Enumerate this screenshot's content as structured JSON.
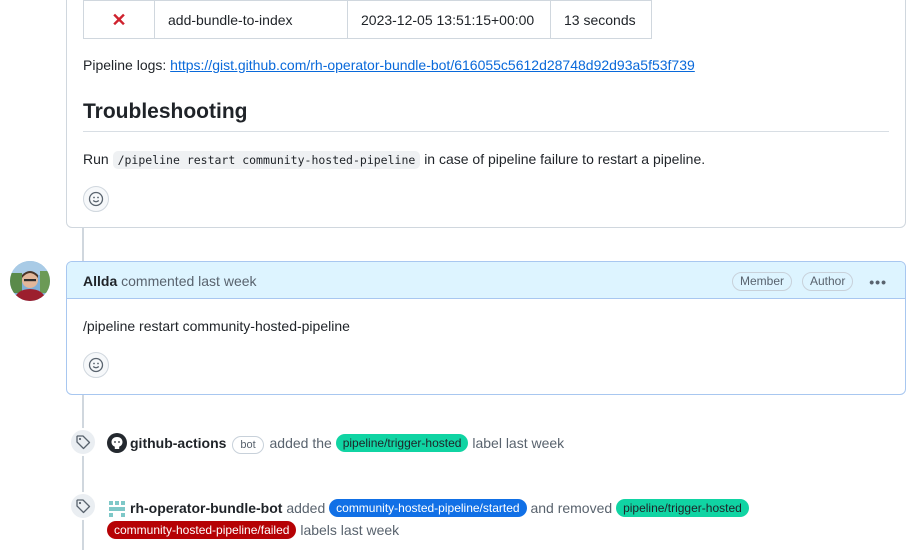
{
  "status_table": {
    "rows": [
      {
        "status_icon": "x-mark-icon",
        "task": "add-bundle-to-index",
        "start_time": "2023-12-05 13:51:15+00:00",
        "duration": "13 seconds"
      }
    ]
  },
  "logs": {
    "prefix": "Pipeline logs:",
    "link_text": "https://gist.github.com/rh-operator-bundle-bot/616055c5612d28748d92d93a5f53f739"
  },
  "troubleshooting": {
    "heading": "Troubleshooting",
    "run_prefix": "Run",
    "command": "/pipeline restart community-hosted-pipeline",
    "run_suffix": "in case of pipeline failure to restart a pipeline."
  },
  "comment": {
    "author": "Allda",
    "action": "commented last week",
    "badges": [
      "Member",
      "Author"
    ],
    "body": "/pipeline restart community-hosted-pipeline"
  },
  "events": [
    {
      "actor": "github-actions",
      "bot_badge": "bot",
      "verb": "added the",
      "label": "pipeline/trigger-hosted",
      "suffix": "label last week"
    },
    {
      "actor": "rh-operator-bundle-bot",
      "verb": "added",
      "label_added": "community-hosted-pipeline/started",
      "middle": "and removed",
      "label_removed_1": "pipeline/trigger-hosted",
      "label_removed_2": "community-hosted-pipeline/failed",
      "suffix": "labels last week"
    }
  ],
  "colors": {
    "label_green": "#10d4a3",
    "label_blue": "#1170e6",
    "label_red": "#b60205",
    "link": "#0969da",
    "error": "#cf222e"
  }
}
